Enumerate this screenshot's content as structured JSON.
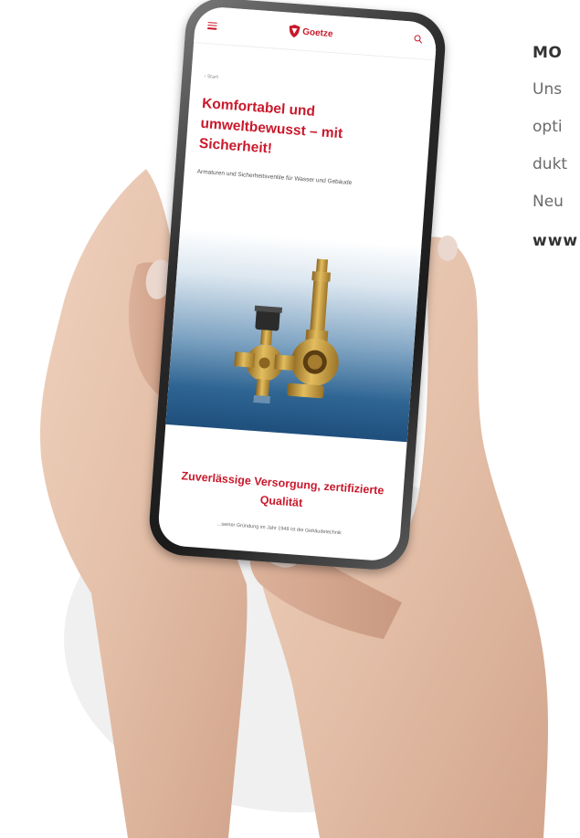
{
  "side_article": {
    "heading": "MO",
    "lines": [
      "Uns",
      "opti",
      "dukt",
      "Neu"
    ],
    "link": "www"
  },
  "phone_site": {
    "brand": "Goetze",
    "breadcrumb": "‹ Start",
    "hero_title": "Komfortabel und umweltbewusst – mit Sicherheit!",
    "hero_subtitle": "Armaturen und Sicherheitsventile für Wasser und Gebäude",
    "section_title": "Zuverlässige Versorgung, zertifizierte Qualität",
    "section_text": "...seiner Gründung im Jahr 1948 ist die Gebäudetechnik"
  },
  "icons": {
    "menu": "hamburger-menu-icon",
    "search": "search-icon",
    "logo": "shield-logo-icon"
  },
  "colors": {
    "brand_red": "#c9182b",
    "hero_blue": "#1f4f7c",
    "brass": "#c9a24a"
  }
}
